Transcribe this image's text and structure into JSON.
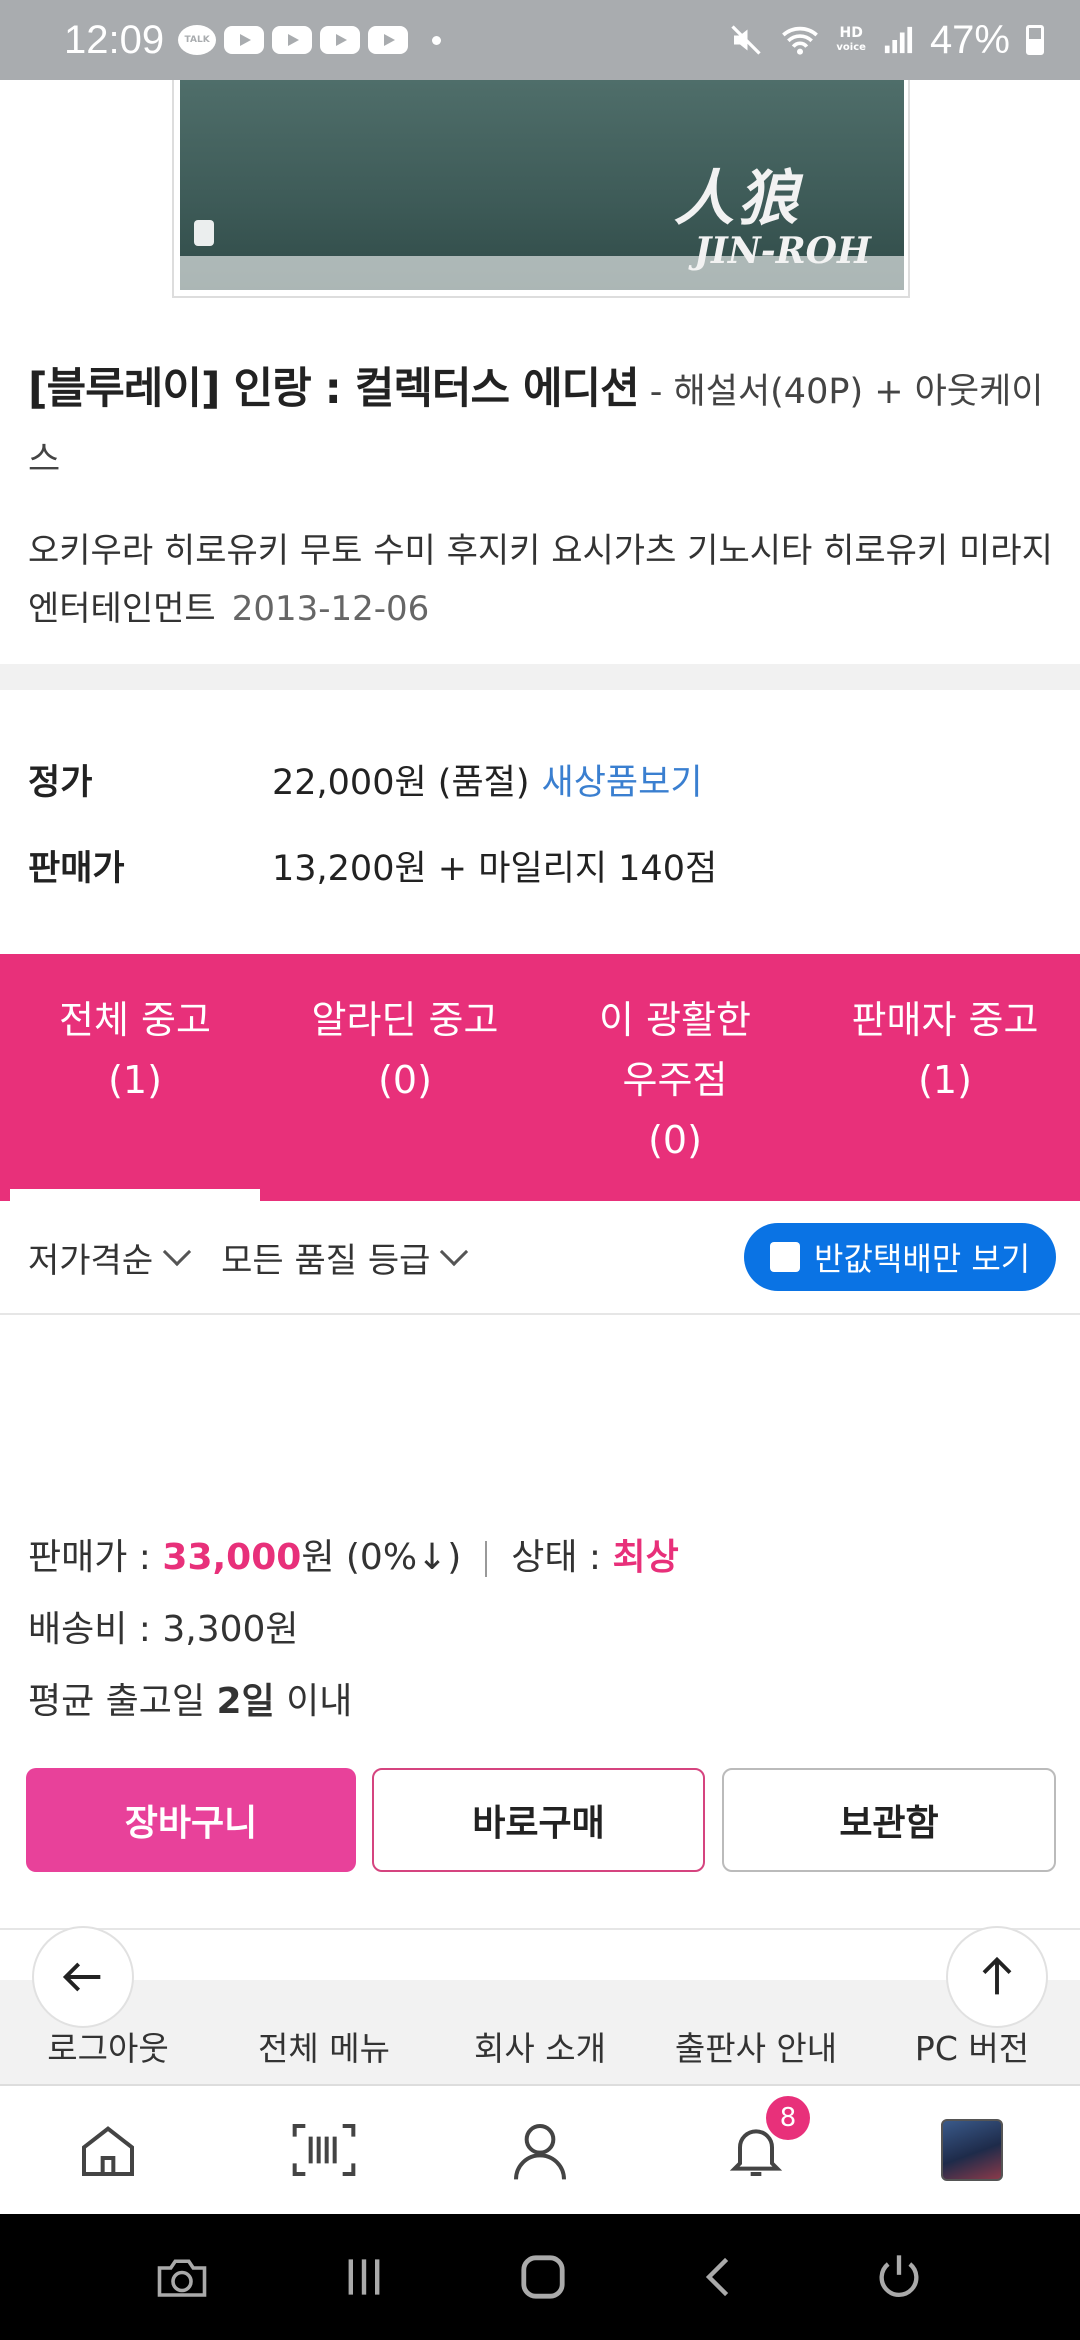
{
  "status_bar": {
    "time": "12:09",
    "talk_label": "TALK",
    "hd_label": "HD",
    "hd_sub": "voice",
    "battery": "47%"
  },
  "product": {
    "cover_text": "人狼",
    "cover_text2": "JIN-ROH",
    "title_main": "[블루레이] 인랑 : 컬렉터스 에디션",
    "title_sub": " - 해설서(40P) + 아웃케이스",
    "credits": "오키우라 히로유키 무토 수미 후지키 요시가츠 기노시타 히로유키   미라지엔터테인먼트",
    "date": "2013-12-06"
  },
  "pricing": {
    "list_label": "정가",
    "list_value": "22,000원 (품절)",
    "new_item_link": "새상품보기",
    "sale_label": "판매가",
    "sale_value": "13,200원 + 마일리지 140점"
  },
  "tabs": [
    {
      "line1": "전체 중고",
      "line2": "(1)",
      "line3": ""
    },
    {
      "line1": "알라딘 중고",
      "line2": "(0)",
      "line3": ""
    },
    {
      "line1": "이 광활한",
      "line2": "우주점",
      "line3": "(0)"
    },
    {
      "line1": "판매자 중고",
      "line2": "(1)",
      "line3": ""
    }
  ],
  "filters": {
    "sort": "저가격순",
    "grade": "모든 품질 등급",
    "half_delivery": "반값택배만 보기"
  },
  "listing": {
    "price_label": "판매가 : ",
    "price_value": "33,000",
    "price_suffix": "원 (0%↓)",
    "condition_label": "상태 : ",
    "condition_value": "최상",
    "shipping": "배송비 : 3,300원",
    "ship_prefix": "평균 출고일 ",
    "ship_days": "2일",
    "ship_suffix": " 이내"
  },
  "actions": {
    "cart": "장바구니",
    "buy_now": "바로구매",
    "wishlist": "보관함"
  },
  "footer_links": [
    "로그아웃",
    "전체 메뉴",
    "회사 소개",
    "출판사 안내",
    "PC 버전"
  ],
  "bottom_nav": {
    "notification_count": "8"
  },
  "colors": {
    "accent": "#e8307a",
    "link": "#3a7fd0",
    "toggle": "#0a73e4"
  }
}
